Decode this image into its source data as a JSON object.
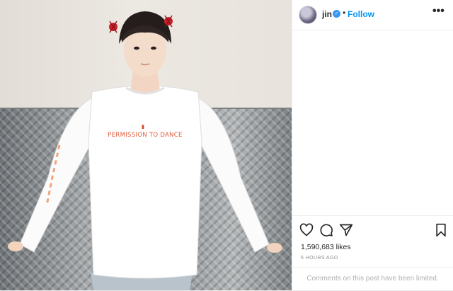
{
  "post": {
    "username": "jin",
    "follow_label": "Follow",
    "separator": "•",
    "more_label": "•••",
    "likes": "1,590,683 likes",
    "time_ago": "6 HOURS AGO",
    "comments_limited": "Comments on this post have been limited.",
    "shirt_print": "PERMISSION TO DANCE"
  },
  "icons": {
    "verified": "verified-badge-icon",
    "like": "heart-icon",
    "comment": "comment-icon",
    "share": "send-icon",
    "save": "bookmark-icon"
  },
  "colors": {
    "accent": "#0095f6",
    "verified": "#3897f0",
    "text": "#262626",
    "muted": "#8e8e8e",
    "shirt_print": "#e05a3a"
  }
}
